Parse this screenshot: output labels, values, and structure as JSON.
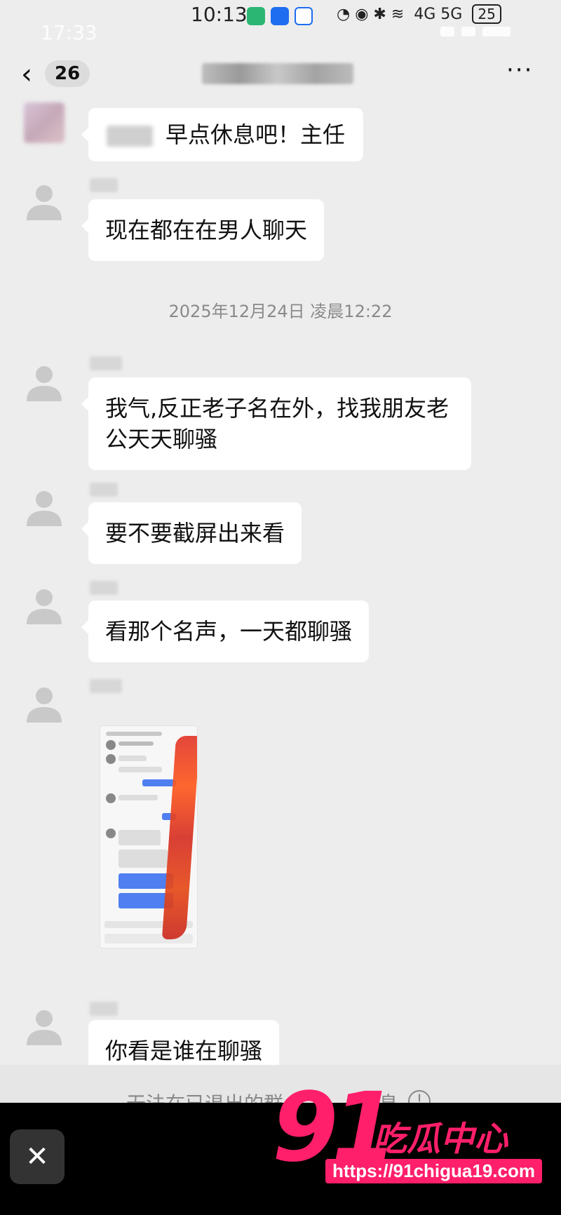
{
  "status_bar": {
    "time": "10:13",
    "battery": "25",
    "network": "4G 5G"
  },
  "ghost_status": {
    "time": "17:33"
  },
  "nav": {
    "back_icon": "chevron-left",
    "unread_count": "26",
    "more_icon": "more-horizontal"
  },
  "messages": [
    {
      "text": "早点休息吧！主任"
    },
    {
      "text": "现在都在在男人聊天"
    },
    {
      "text": "我气,反正老子名在外，找我朋友老公天天聊骚"
    },
    {
      "text": "要不要截屏出来看"
    },
    {
      "text": "看那个名声，一天都聊骚"
    },
    {
      "text": "你看是谁在聊骚"
    }
  ],
  "timestamp": "2025年12月24日 凌晨12:22",
  "exited_notice": "无法在已退出的群",
  "exited_notice_tail": "息",
  "close_icon": "close",
  "watermark": {
    "logo": "91",
    "brand": "吃瓜中心",
    "url": "https://91chigua19.com"
  }
}
